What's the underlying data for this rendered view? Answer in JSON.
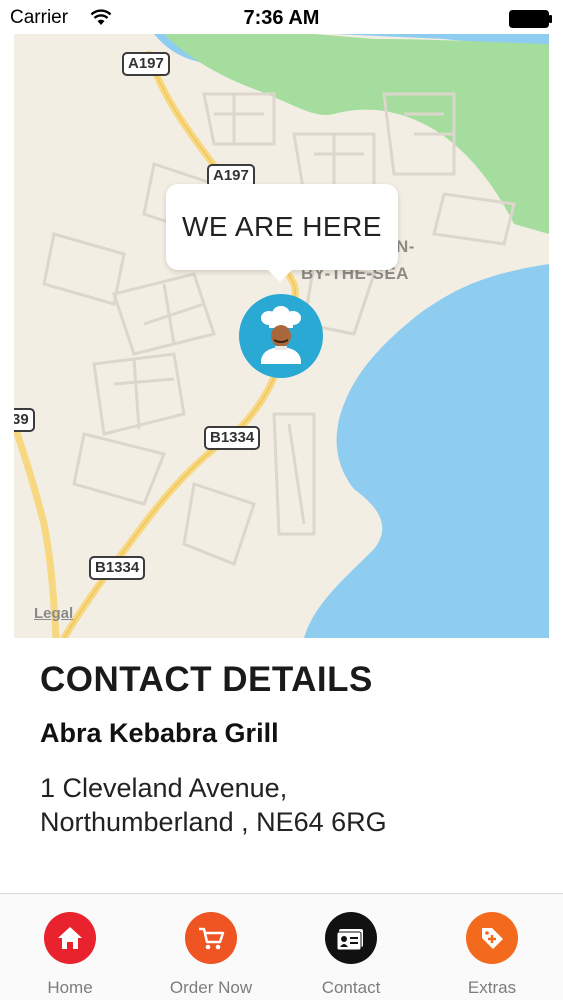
{
  "status_bar": {
    "carrier": "Carrier",
    "time": "7:36 AM"
  },
  "map": {
    "callout_text": "WE ARE HERE",
    "road_labels": [
      "A197",
      "A197",
      "B1334",
      "B1334",
      "39"
    ],
    "place_labels": [
      "N-",
      "BY-THE-SEA"
    ],
    "legal": "Legal"
  },
  "contact": {
    "heading": "CONTACT DETAILS",
    "business_name": "Abra Kebabra Grill",
    "address_line1": "1 Cleveland Avenue,",
    "address_line2": "Northumberland , NE64 6RG"
  },
  "tabs": [
    {
      "label": "Home",
      "icon": "home-icon",
      "color": "#e8232e"
    },
    {
      "label": "Order Now",
      "icon": "cart-icon",
      "color": "#ef5423"
    },
    {
      "label": "Contact",
      "icon": "contact-card-icon",
      "color": "#111111"
    },
    {
      "label": "Extras",
      "icon": "tag-plus-icon",
      "color": "#f46a1c"
    }
  ]
}
